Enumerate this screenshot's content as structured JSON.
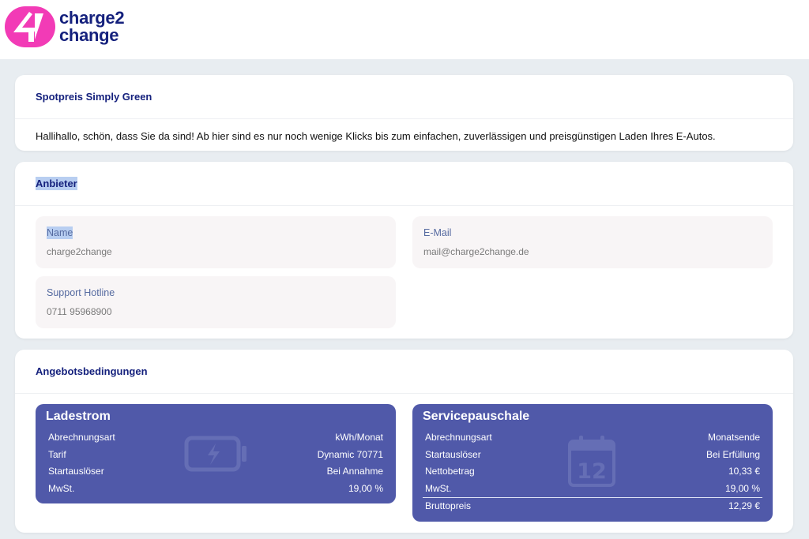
{
  "brand": {
    "line1": "charge2",
    "line2": "change",
    "colors": {
      "pink": "#f23bb6",
      "navy": "#15217d"
    }
  },
  "intro_card": {
    "title": "Spotpreis Simply Green",
    "text": "Hallihallo, schön, dass Sie da sind! Ab hier sind es nur noch wenige Klicks bis zum einfachen, zuverlässigen und preisgünstigen Laden Ihres E-Autos."
  },
  "provider_card": {
    "title": "Anbieter",
    "fields": [
      {
        "label": "Name",
        "value": "charge2change"
      },
      {
        "label": "E-Mail",
        "value": "mail@charge2change.de"
      },
      {
        "label": "Support Hotline",
        "value": "0711 95968900"
      }
    ]
  },
  "conditions_card": {
    "title": "Angebotsbedingungen",
    "offers": [
      {
        "title": "Ladestrom",
        "icon": "battery-charging-icon",
        "rows": [
          {
            "label": "Abrechnungsart",
            "value": "kWh/Monat"
          },
          {
            "label": "Tarif",
            "value": "Dynamic 70771"
          },
          {
            "label": "Startauslöser",
            "value": "Bei Annahme"
          },
          {
            "label": "MwSt.",
            "value": "19,00 %"
          }
        ]
      },
      {
        "title": "Servicepauschale",
        "icon": "calendar-icon",
        "calendar_day": "12",
        "rows": [
          {
            "label": "Abrechnungsart",
            "value": "Monatsende"
          },
          {
            "label": "Startauslöser",
            "value": "Bei Erfüllung"
          },
          {
            "label": "Nettobetrag",
            "value": "10,33 €"
          },
          {
            "label": "MwSt.",
            "value": "19,00 %"
          },
          {
            "label": "Bruttopreis",
            "value": "12,29 €"
          }
        ]
      }
    ]
  },
  "colors": {
    "page_bg": "#e8edf1",
    "offer_bg": "#5059a9",
    "field_bg": "#f8f5f6",
    "heading": "#15217d"
  }
}
